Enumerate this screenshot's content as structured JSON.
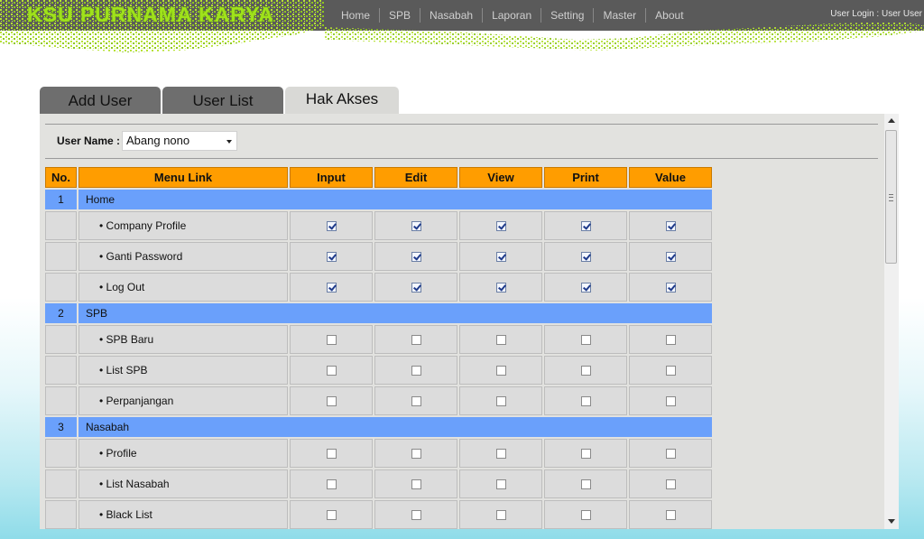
{
  "header": {
    "logo": "KSU PURNAMA KARYA",
    "nav": [
      "Home",
      "SPB",
      "Nasabah",
      "Laporan",
      "Setting",
      "Master",
      "About"
    ],
    "user_info": "User Login : User User"
  },
  "tabs": [
    {
      "label": "Add User",
      "active": false
    },
    {
      "label": "User List",
      "active": false
    },
    {
      "label": "Hak Akses",
      "active": true
    }
  ],
  "form": {
    "user_name_label": "User Name :",
    "user_name_value": "Abang nono"
  },
  "table": {
    "headers": [
      "No.",
      "Menu Link",
      "Input",
      "Edit",
      "View",
      "Print",
      "Value"
    ],
    "groups": [
      {
        "no": "1",
        "name": "Home",
        "items": [
          {
            "label": "• Company Profile",
            "checks": [
              true,
              true,
              true,
              true,
              true
            ]
          },
          {
            "label": "• Ganti Password",
            "checks": [
              true,
              true,
              true,
              true,
              true
            ]
          },
          {
            "label": "• Log Out",
            "checks": [
              true,
              true,
              true,
              true,
              true
            ]
          }
        ]
      },
      {
        "no": "2",
        "name": "SPB",
        "items": [
          {
            "label": "• SPB Baru",
            "checks": [
              false,
              false,
              false,
              false,
              false
            ]
          },
          {
            "label": "• List SPB",
            "checks": [
              false,
              false,
              false,
              false,
              false
            ]
          },
          {
            "label": "• Perpanjangan",
            "checks": [
              false,
              false,
              false,
              false,
              false
            ]
          }
        ]
      },
      {
        "no": "3",
        "name": "Nasabah",
        "items": [
          {
            "label": "• Profile",
            "checks": [
              false,
              false,
              false,
              false,
              false
            ]
          },
          {
            "label": "• List Nasabah",
            "checks": [
              false,
              false,
              false,
              false,
              false
            ]
          },
          {
            "label": "• Black List",
            "checks": [
              false,
              false,
              false,
              false,
              false
            ]
          }
        ]
      }
    ]
  },
  "colors": {
    "header_orange": "#ff9d00",
    "group_blue": "#6aa0fb",
    "logo_green": "#9fe21a",
    "topbar": "#5a5a5a"
  },
  "icons": {
    "dropdown": "chevron-down-icon",
    "checkbox": "checkbox-icon",
    "scroll_up": "scroll-up-icon",
    "scroll_down": "scroll-down-icon"
  }
}
